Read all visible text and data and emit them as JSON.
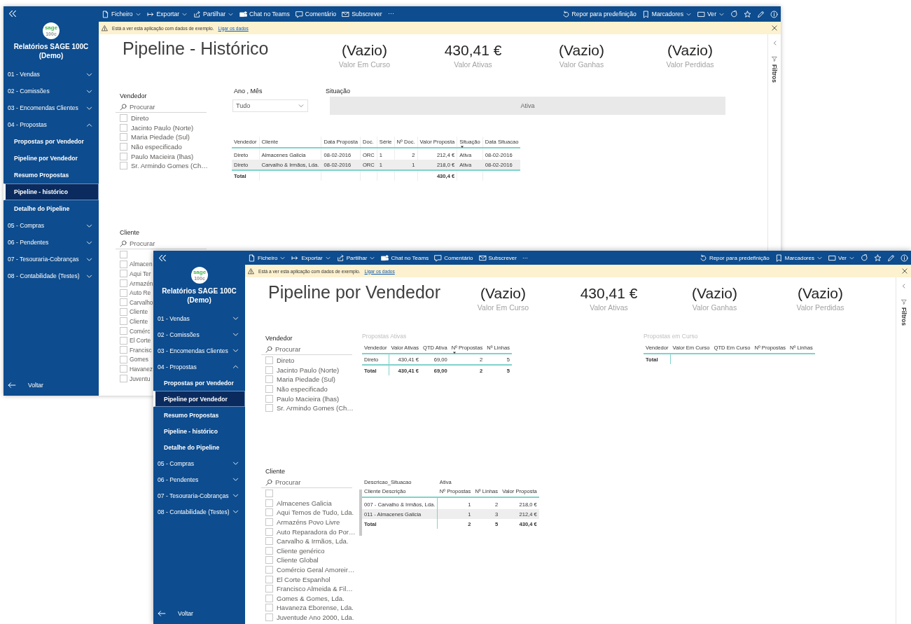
{
  "windows": [
    {
      "toolbar": {
        "left": [
          {
            "label": "Ficheiro",
            "kind": "file",
            "dropdown": true
          },
          {
            "label": "Exportar",
            "kind": "export",
            "dropdown": true
          },
          {
            "label": "Partilhar",
            "kind": "share",
            "dropdown": true
          },
          {
            "label": "Chat no Teams",
            "kind": "teams",
            "dropdown": false
          },
          {
            "label": "Comentário",
            "kind": "comment",
            "dropdown": false
          },
          {
            "label": "Subscrever",
            "kind": "mail",
            "dropdown": false
          },
          {
            "label": "⋯",
            "kind": "more",
            "dropdown": false
          }
        ],
        "right": [
          {
            "label": "Repor para predefinição",
            "kind": "reset",
            "dropdown": false
          },
          {
            "label": "Marcadores",
            "kind": "bookmark",
            "dropdown": true
          },
          {
            "label": "Ver",
            "kind": "view",
            "dropdown": true
          },
          {
            "kind": "refresh",
            "dropdown": false
          },
          {
            "kind": "star",
            "dropdown": false
          },
          {
            "kind": "pencil",
            "dropdown": false
          },
          {
            "kind": "info",
            "dropdown": false
          }
        ]
      },
      "banner": {
        "text": "Está a ver esta aplicação com dados de exemplo.",
        "link": "Ligar os dados"
      },
      "sidebar": {
        "logo": [
          "sage",
          "100c"
        ],
        "title": "Relatórios SAGE 100C (Demo)",
        "nav": [
          {
            "label": "01 - Vendas",
            "expanded": false
          },
          {
            "label": "02 - Comissões",
            "expanded": false
          },
          {
            "label": "03 - Encomendas Clientes",
            "expanded": false
          },
          {
            "label": "04 - Propostas",
            "expanded": true,
            "children": [
              {
                "label": "Propostas por Vendedor",
                "selected": false
              },
              {
                "label": "Pipeline por Vendedor",
                "selected": false
              },
              {
                "label": "Resumo Propostas",
                "selected": false
              },
              {
                "label": "Pipeline - histórico",
                "selected": true
              },
              {
                "label": "Detalhe do Pipeline",
                "selected": false
              }
            ]
          },
          {
            "label": "05 - Compras",
            "expanded": false
          },
          {
            "label": "06 - Pendentes",
            "expanded": false
          },
          {
            "label": "07 - Tesouraria-Cobranças",
            "expanded": false
          },
          {
            "label": "08 - Contabilidade (Testes)",
            "expanded": false
          }
        ],
        "back": "Voltar"
      },
      "filters": {
        "label": "Filtros"
      },
      "report": {
        "visuals": [
          {
            "kind": "title",
            "text": "Pipeline - Histórico"
          },
          {
            "kind": "cards",
            "items": [
              {
                "value": "(Vazio)",
                "label": "Valor Em Curso"
              },
              {
                "value": "430,41 €",
                "label": "Valor Ativas"
              },
              {
                "value": "(Vazio)",
                "label": "Valor Ganhas"
              },
              {
                "value": "(Vazio)",
                "label": "Valor Perdidas"
              }
            ]
          },
          {
            "kind": "list_slicer",
            "title": "Vendedor",
            "placeholder": "Procurar",
            "items": [
              {
                "label": "Direto",
                "checked": false
              },
              {
                "label": "Jacinto Paulo (Norte)",
                "checked": false
              },
              {
                "label": "Maria Piedade (Sul)",
                "checked": false
              },
              {
                "label": "Não especificado",
                "checked": false
              },
              {
                "label": "Paulo Macieira (lhas)",
                "checked": false
              },
              {
                "label": "Sr. Armindo Gomes (Ch…",
                "checked": false
              }
            ]
          },
          {
            "kind": "dropdown",
            "title": "Ano , Mês",
            "value": "Tudo"
          },
          {
            "kind": "tile_slicer",
            "title": "Situação",
            "tile": "Ativa"
          },
          {
            "kind": "table",
            "columns": [
              {
                "label": "Vendedor",
                "kind": "text",
                "sorted": false,
                "total": "Total"
              },
              {
                "label": "Cliente",
                "kind": "text",
                "sorted": false
              },
              {
                "label": "Data Proposta",
                "kind": "text",
                "sorted": false
              },
              {
                "label": "Doc.",
                "kind": "text",
                "sorted": false
              },
              {
                "label": "Série",
                "kind": "text",
                "sorted": false
              },
              {
                "label": "Nº Doc.",
                "kind": "number",
                "sorted": false
              },
              {
                "label": "Valor Proposta",
                "kind": "number",
                "sorted": false,
                "total": "430,4 €"
              },
              {
                "label": "Situação",
                "kind": "text",
                "sorted": true
              },
              {
                "label": "Data Situacao",
                "kind": "text",
                "sorted": false
              }
            ],
            "rows": [
              [
                "Direto",
                "Almacenes Galicia",
                "08-02-2016",
                "ORC",
                "1",
                "2",
                "212,4 €",
                "Ativa",
                "08-02-2016"
              ],
              [
                "Direto",
                "Carvalho & Irmãos, Lda.",
                "08-02-2016",
                "ORC",
                "1",
                "1",
                "218,0 €",
                "Ativa",
                "08-02-2016"
              ]
            ]
          },
          {
            "kind": "list_slicer",
            "title": "Cliente",
            "placeholder": "Procurar",
            "items": [
              {
                "checked": false
              },
              {
                "label": "Almacen",
                "checked": false
              },
              {
                "label": "Aqui Ter",
                "checked": false
              },
              {
                "label": "Armazén",
                "checked": false
              },
              {
                "label": "Auto Re",
                "checked": false
              },
              {
                "label": "Carvalho",
                "checked": false
              },
              {
                "label": "Cliente",
                "checked": false
              },
              {
                "label": "Cliente",
                "checked": false
              },
              {
                "label": "Comérc",
                "checked": false
              },
              {
                "label": "El Corte",
                "checked": false
              },
              {
                "label": "Francisc",
                "checked": false
              },
              {
                "label": "Gomes",
                "checked": false
              },
              {
                "label": "Havanez",
                "checked": false
              },
              {
                "label": "Juventu",
                "checked": false
              }
            ]
          }
        ]
      }
    },
    {
      "toolbar": {
        "left": [
          {
            "label": "Ficheiro",
            "kind": "file",
            "dropdown": true
          },
          {
            "label": "Exportar",
            "kind": "export",
            "dropdown": true
          },
          {
            "label": "Partilhar",
            "kind": "share",
            "dropdown": true
          },
          {
            "label": "Chat no Teams",
            "kind": "teams",
            "dropdown": false
          },
          {
            "label": "Comentário",
            "kind": "comment",
            "dropdown": false
          },
          {
            "label": "Subscrever",
            "kind": "mail",
            "dropdown": false
          },
          {
            "label": "⋯",
            "kind": "more",
            "dropdown": false
          }
        ],
        "right": [
          {
            "label": "Repor para predefinição",
            "kind": "reset",
            "dropdown": false
          },
          {
            "label": "Marcadores",
            "kind": "bookmark",
            "dropdown": true
          },
          {
            "label": "Ver",
            "kind": "view",
            "dropdown": true
          },
          {
            "kind": "refresh",
            "dropdown": false
          },
          {
            "kind": "star",
            "dropdown": false
          },
          {
            "kind": "pencil",
            "dropdown": false
          },
          {
            "kind": "info",
            "dropdown": false
          }
        ]
      },
      "banner": {
        "text": "Está a ver esta aplicação com dados de exemplo.",
        "link": "Ligar os dados"
      },
      "sidebar": {
        "logo": [
          "sage",
          "100c"
        ],
        "title": "Relatórios SAGE 100C (Demo)",
        "nav": [
          {
            "label": "01 - Vendas",
            "expanded": false
          },
          {
            "label": "02 - Comissões",
            "expanded": false
          },
          {
            "label": "03 - Encomendas Clientes",
            "expanded": false
          },
          {
            "label": "04 - Propostas",
            "expanded": true,
            "children": [
              {
                "label": "Propostas por Vendedor",
                "selected": false
              },
              {
                "label": "Pipeline por Vendedor",
                "selected": true
              },
              {
                "label": "Resumo Propostas",
                "selected": false
              },
              {
                "label": "Pipeline - histórico",
                "selected": false
              },
              {
                "label": "Detalhe do Pipeline",
                "selected": false
              }
            ]
          },
          {
            "label": "05 - Compras",
            "expanded": false
          },
          {
            "label": "06 - Pendentes",
            "expanded": false
          },
          {
            "label": "07 - Tesouraria-Cobranças",
            "expanded": false
          },
          {
            "label": "08 - Contabilidade (Testes)",
            "expanded": false
          }
        ],
        "back": "Voltar"
      },
      "filters": {
        "label": "Filtros"
      },
      "report": {
        "visuals": [
          {
            "kind": "title",
            "text": "Pipeline por Vendedor"
          },
          {
            "kind": "cards",
            "items": [
              {
                "value": "(Vazio)",
                "label": "Valor Em Curso"
              },
              {
                "value": "430,41 €",
                "label": "Valor Ativas"
              },
              {
                "value": "(Vazio)",
                "label": "Valor Ganhas"
              },
              {
                "value": "(Vazio)",
                "label": "Valor Perdidas"
              }
            ]
          },
          {
            "kind": "list_slicer",
            "title": "Vendedor",
            "placeholder": "Procurar",
            "items": [
              {
                "label": "Direto",
                "checked": false
              },
              {
                "label": "Jacinto Paulo (Norte)",
                "checked": false
              },
              {
                "label": "Maria Piedade (Sul)",
                "checked": false
              },
              {
                "label": "Não especificado",
                "checked": false
              },
              {
                "label": "Paulo Macieira (lhas)",
                "checked": false
              },
              {
                "label": "Sr. Armindo Gomes (Ch…",
                "checked": false
              }
            ]
          },
          {
            "kind": "table",
            "title": "Propostas Ativas",
            "columns": [
              {
                "label": "Vendedor",
                "kind": "text",
                "sorted": false,
                "total": "Total"
              },
              {
                "label": "Valor Ativas",
                "kind": "number",
                "sorted": false,
                "total": "430,41 €"
              },
              {
                "label": "QTD Ativa",
                "kind": "number",
                "sorted": false,
                "total": "69,00"
              },
              {
                "label": "Nº Propostas",
                "kind": "number",
                "sorted": true,
                "total": "2"
              },
              {
                "label": "Nº Linhas",
                "kind": "number",
                "sorted": false,
                "total": "5"
              }
            ],
            "rows": [
              [
                "Direto",
                "430,41 €",
                "69,00",
                "2",
                "5"
              ]
            ]
          },
          {
            "kind": "table",
            "title": "Propostas em Curso",
            "columns": [
              {
                "label": "Vendedor",
                "kind": "text",
                "sorted": false,
                "total": "Total"
              },
              {
                "label": "Valor Em Curso",
                "kind": "number",
                "sorted": false
              },
              {
                "label": "QTD Em Curso",
                "kind": "number",
                "sorted": false
              },
              {
                "label": "Nº Propostas",
                "kind": "number",
                "sorted": false
              },
              {
                "label": "Nº Linhas",
                "kind": "number",
                "sorted": false
              }
            ]
          },
          {
            "kind": "list_slicer",
            "title": "Cliente",
            "placeholder": "Procurar",
            "items": [
              {
                "checked": false
              },
              {
                "label": "Almacenes Galicia",
                "checked": false
              },
              {
                "label": "Aqui Temos de Tudo, Lda.",
                "checked": false
              },
              {
                "label": "Armazéns Povo Livre",
                "checked": false
              },
              {
                "label": "Auto Reparadora do Por…",
                "checked": false
              },
              {
                "label": "Carvalho & Irmãos, Lda.",
                "checked": false
              },
              {
                "label": "Cliente genérico",
                "checked": false
              },
              {
                "label": "Cliente Global",
                "checked": false
              },
              {
                "label": "Comércio Geral Amoreir…",
                "checked": false
              },
              {
                "label": "El Corte Espanhol",
                "checked": false
              },
              {
                "label": "Francisco Almeida & Fil…",
                "checked": false
              },
              {
                "label": "Gomes & Gomes, Lda.",
                "checked": false
              },
              {
                "label": "Havaneza Eborense, Lda.",
                "checked": false
              },
              {
                "label": "Juventude Ano 2000, Lda.",
                "checked": false
              }
            ]
          },
          {
            "kind": "matrix",
            "row_header": "Descricao_Situacao",
            "column_group": "Ativa",
            "columns": [
              {
                "label": "Cliente Descrição",
                "kind": "text"
              },
              {
                "label": "Nº Propostas",
                "kind": "number"
              },
              {
                "label": "Nº Linhas",
                "kind": "number"
              },
              {
                "label": "Valor Proposta",
                "kind": "number"
              }
            ],
            "rows": [
              [
                "007 - Carvalho & Irmãos, Lda.",
                "1",
                "2",
                "218,0 €"
              ],
              [
                "011 - Almacenes Galicia",
                "1",
                "3",
                "212,4 €"
              ]
            ],
            "total": [
              "Total",
              "2",
              "5",
              "430,4 €"
            ]
          }
        ]
      }
    }
  ]
}
